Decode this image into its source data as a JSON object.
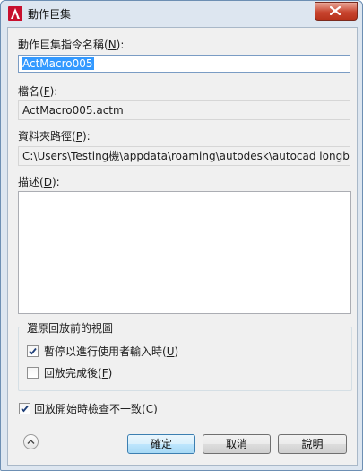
{
  "window": {
    "title": "動作巨集"
  },
  "macro_name": {
    "label": "動作巨集指令名稱(N):",
    "label_pre": "動作巨集指令名稱(",
    "label_key": "N",
    "label_post": "):",
    "value": "ActMacro005"
  },
  "file_name": {
    "label_pre": "檔名(",
    "label_key": "F",
    "label_post": "):",
    "value": "ActMacro005.actm"
  },
  "folder_path": {
    "label_pre": "資料夾路徑(",
    "label_key": "P",
    "label_post": "):",
    "value": "C:\\Users\\Testing機\\appdata\\roaming\\autodesk\\autocad longbow"
  },
  "description": {
    "label_pre": "描述(",
    "label_key": "D",
    "label_post": "):",
    "value": ""
  },
  "restore_view": {
    "title": "還原回放前的視圖",
    "pause_checkbox": {
      "label_pre": "暫停以進行使用者輸入時(",
      "label_key": "U",
      "label_post": ")",
      "checked": true
    },
    "after_playback_checkbox": {
      "label_pre": "回放完成後(",
      "label_key": "F",
      "label_post": ")",
      "checked": false
    }
  },
  "inconsistency_checkbox": {
    "label_pre": "回放開始時檢查不一致(",
    "label_key": "C",
    "label_post": ")",
    "checked": true
  },
  "buttons": {
    "ok": "確定",
    "cancel": "取消",
    "help": "說明"
  },
  "colors": {
    "selection": "#3399ff",
    "close_button": "#c8452f",
    "accent_red": "#c8102e"
  },
  "icons": {
    "app": "autocad-icon",
    "close": "close-icon",
    "expand": "chevron-up-icon",
    "check": "checkmark-icon"
  }
}
